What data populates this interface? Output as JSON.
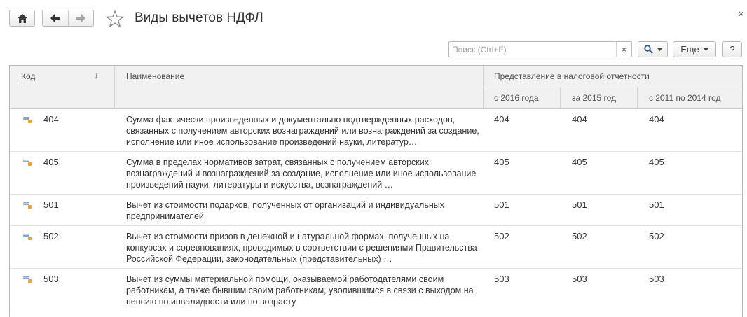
{
  "window": {
    "title": "Виды вычетов НДФЛ",
    "close_glyph": "×"
  },
  "toolbar": {
    "search_placeholder": "Поиск (Ctrl+F)",
    "search_value": "",
    "clear_glyph": "×",
    "more_label": "Еще",
    "help_label": "?"
  },
  "table": {
    "headers": {
      "code": "Код",
      "sort_glyph": "↓",
      "name": "Наименование",
      "group": "Представление в налоговой отчетности",
      "col_2016": "с 2016 года",
      "col_2015": "за 2015 год",
      "col_2011": "с 2011 по 2014  год"
    },
    "rows": [
      {
        "code": "404",
        "name": "Сумма фактически произведенных и документально подтвержденных расходов, связанных с получением авторских вознаграждений или вознаграждений за создание, исполнение или иное использование произведений науки, литератур…",
        "v2016": "404",
        "v2015": "404",
        "v2011": "404"
      },
      {
        "code": "405",
        "name": "Сумма в пределах нормативов затрат, связанных с получением авторских вознаграждений и вознаграждений за создание, исполнение или иное использование произведений науки, литературы и искусства, вознаграждений …",
        "v2016": "405",
        "v2015": "405",
        "v2011": "405"
      },
      {
        "code": "501",
        "name": "Вычет из стоимости подарков, полученных от организаций и индивидуальных предпринимателей",
        "v2016": "501",
        "v2015": "501",
        "v2011": "501"
      },
      {
        "code": "502",
        "name": "Вычет из стоимости призов в денежной и натуральной формах, полученных на конкурсах и соревнованиях, проводимых в соответствии с решениями Правительства Российской Федерации, законодательных (представительных) …",
        "v2016": "502",
        "v2015": "502",
        "v2011": "502"
      },
      {
        "code": "503",
        "name": "Вычет из суммы материальной помощи, оказываемой работодателями своим работникам, а также бывшим своим работникам, уволившимся в связи с выходом на пенсию по инвалидности или по возрасту",
        "v2016": "503",
        "v2015": "503",
        "v2011": "503"
      }
    ]
  },
  "icons": {
    "home": "home-icon",
    "back": "arrow-left-icon",
    "forward": "arrow-right-icon",
    "favorite": "star-icon",
    "search": "search-icon",
    "row": "catalog-item-icon"
  }
}
